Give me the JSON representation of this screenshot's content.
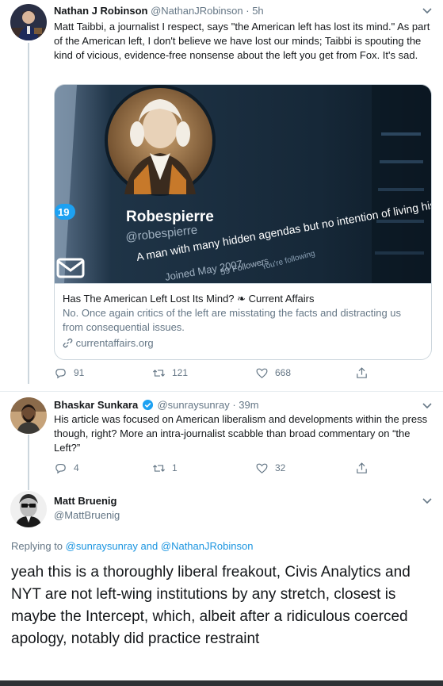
{
  "tweets": [
    {
      "name": "Nathan J Robinson",
      "handle": "@NathanJRobinson",
      "time": "· 5h",
      "text": "Matt Taibbi, a journalist I respect, says \"the American left has lost its mind.\" As part of the American left, I don't believe we have lost our minds; Taibbi is spouting the kind of vicious, evidence-free nonsense about the left you get from Fox. It's sad.",
      "card": {
        "profile_name": "Robespierre",
        "profile_handle": "@robespierre",
        "profile_bio": "A man with many hidden agendas but no intention of living his head in this incarnation.",
        "joined": "Joined May 2007",
        "followers": "59 Followers",
        "following": "You're following",
        "notif_count": "19",
        "title": "Has The American Left Lost Its Mind? ❧ Current Affairs",
        "description": "No. Once again critics of the left are misstating the facts and distracting us from consequential issues.",
        "domain": "currentaffairs.org"
      },
      "replies": "91",
      "retweets": "121",
      "likes": "668"
    },
    {
      "name": "Bhaskar Sunkara",
      "handle": "@sunraysunray",
      "time": "· 39m",
      "text": "His article was focused on American liberalism and developments within the press though, right? More an intra-journalist scabble than broad commentary on “the Left?”",
      "replies": "4",
      "retweets": "1",
      "likes": "32"
    },
    {
      "name": "Matt Bruenig",
      "handle": "@MattBruenig",
      "replying_prefix": "Replying to",
      "replying_to_1": "@sunraysunray",
      "replying_and": "and",
      "replying_to_2": "@NathanJRobinson",
      "text": "yeah this is a thoroughly liberal freakout, Civis Analytics and NYT are not left-wing institutions by any stretch, closest is maybe the Intercept, which, albeit after a ridiculous coerced apology, notably did practice restraint"
    }
  ],
  "icons": {
    "reply": "reply-icon",
    "retweet": "retweet-icon",
    "like": "heart-icon",
    "share": "share-icon",
    "menu": "chevron-down-icon",
    "link": "link-icon"
  },
  "colors": {
    "text": "#14171a",
    "secondary": "#657786",
    "link": "#1b95e0",
    "border": "#ccd6dd"
  }
}
